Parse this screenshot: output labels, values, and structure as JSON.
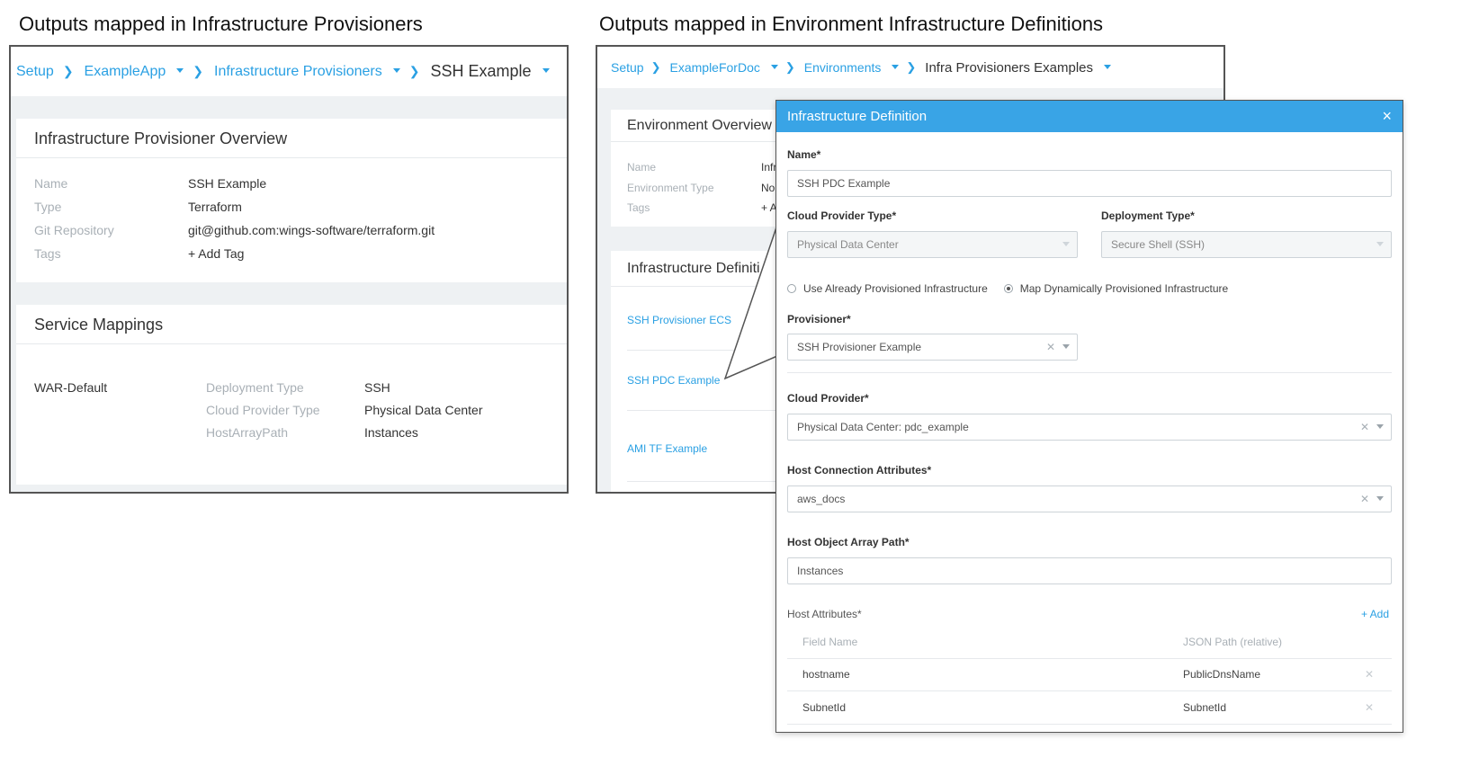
{
  "headings": {
    "left": "Outputs mapped in Infrastructure Provisioners",
    "right": "Outputs mapped in Environment Infrastructure Definitions"
  },
  "left_panel": {
    "breadcrumb": [
      "Setup",
      "ExampleApp",
      "Infrastructure Provisioners",
      "SSH Example"
    ],
    "overview": {
      "title": "Infrastructure Provisioner Overview",
      "rows": [
        {
          "label": "Name",
          "value": "SSH Example"
        },
        {
          "label": "Type",
          "value": "Terraform"
        },
        {
          "label": "Git Repository",
          "value": "git@github.com:wings-software/terraform.git"
        },
        {
          "label": "Tags",
          "value": "+ Add Tag"
        }
      ]
    },
    "service_mappings": {
      "title": "Service Mappings",
      "service": "WAR-Default",
      "rows": [
        {
          "label": "Deployment Type",
          "value": "SSH"
        },
        {
          "label": "Cloud Provider Type",
          "value": "Physical Data Center"
        },
        {
          "label": "HostArrayPath",
          "value": "Instances"
        }
      ]
    }
  },
  "right_panel": {
    "breadcrumb": [
      "Setup",
      "ExampleForDoc",
      "Environments",
      "Infra Provisioners Examples"
    ],
    "overview": {
      "title": "Environment Overview",
      "rows": [
        {
          "label": "Name",
          "value": "Infr"
        },
        {
          "label": "Environment Type",
          "value": "No"
        },
        {
          "label": "Tags",
          "value": "+ A"
        }
      ]
    },
    "infra_definitions": {
      "title": "Infrastructure Definiti",
      "items": [
        "SSH Provisioner ECS",
        "SSH PDC Example",
        "AMI TF Example"
      ]
    }
  },
  "modal": {
    "title": "Infrastructure Definition",
    "close": "×",
    "name_label": "Name*",
    "name_value": "SSH PDC Example",
    "cloud_provider_type_label": "Cloud Provider Type*",
    "cloud_provider_type_value": "Physical Data Center",
    "deployment_type_label": "Deployment Type*",
    "deployment_type_value": "Secure Shell (SSH)",
    "radio_use_provisioned": "Use Already Provisioned Infrastructure",
    "radio_map_dynamic": "Map Dynamically Provisioned Infrastructure",
    "selected_radio": "Map Dynamically Provisioned Infrastructure",
    "provisioner_label": "Provisioner*",
    "provisioner_value": "SSH Provisioner Example",
    "cloud_provider_label": "Cloud Provider*",
    "cloud_provider_value": "Physical Data Center: pdc_example",
    "host_connection_label": "Host Connection Attributes*",
    "host_connection_value": "aws_docs",
    "host_array_path_label": "Host Object Array Path*",
    "host_array_path_value": "Instances",
    "host_attributes_label": "Host Attributes*",
    "add_label": "+ Add",
    "table_headers": [
      "Field Name",
      "JSON Path (relative)"
    ],
    "table_rows": [
      {
        "field": "hostname",
        "path": "PublicDnsName"
      },
      {
        "field": "SubnetId",
        "path": "SubnetId"
      }
    ]
  },
  "colors": {
    "accent": "#39a4e6",
    "link": "#2aa0e3",
    "panel_bg": "#eef1f3"
  },
  "icons": [
    "chevron-right-icon",
    "caret-down-icon",
    "close-icon",
    "clear-icon",
    "radio-icon"
  ]
}
